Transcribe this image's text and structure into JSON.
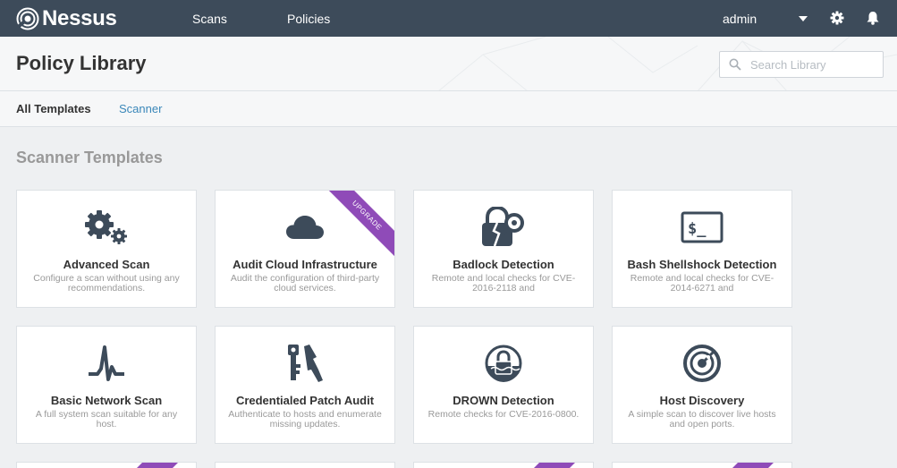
{
  "app": {
    "name": "Nessus"
  },
  "nav": {
    "scans": "Scans",
    "policies": "Policies",
    "user": "admin"
  },
  "icons": {
    "logo": "nessus-logo-icon",
    "settings": "gear-icon",
    "notifications": "bell-icon",
    "search": "search-icon"
  },
  "header": {
    "title": "Policy Library"
  },
  "search": {
    "placeholder": "Search Library",
    "value": ""
  },
  "tabs": {
    "all_templates": "All Templates",
    "scanner": "Scanner"
  },
  "section": {
    "title": "Scanner Templates"
  },
  "colors": {
    "topbar": "#3d4b5a",
    "icon": "#3d4b5a",
    "ribbon": "#8f4bb8",
    "link": "#3a87b9"
  },
  "templates": [
    {
      "name": "Advanced Scan",
      "description": "Configure a scan without using any recommendations.",
      "icon": "gears-icon",
      "ribbon": ""
    },
    {
      "name": "Audit Cloud Infrastructure",
      "description": "Audit the configuration of third-party cloud services.",
      "icon": "cloud-icon",
      "ribbon": "UPGRADE"
    },
    {
      "name": "Badlock Detection",
      "description": "Remote and local checks for CVE-2016-2118 and",
      "icon": "broken-lock-icon",
      "ribbon": ""
    },
    {
      "name": "Bash Shellshock Detection",
      "description": "Remote and local checks for CVE-2014-6271 and",
      "icon": "terminal-icon",
      "ribbon": ""
    },
    {
      "name": "Basic Network Scan",
      "description": "A full system scan suitable for any host.",
      "icon": "pulse-icon",
      "ribbon": ""
    },
    {
      "name": "Credentialed Patch Audit",
      "description": "Authenticate to hosts and enumerate missing updates.",
      "icon": "key-icon",
      "ribbon": ""
    },
    {
      "name": "DROWN Detection",
      "description": "Remote checks for CVE-2016-0800.",
      "icon": "sinking-lock-icon",
      "ribbon": ""
    },
    {
      "name": "Host Discovery",
      "description": "A simple scan to discover live hosts and open ports.",
      "icon": "radar-icon",
      "ribbon": ""
    }
  ]
}
